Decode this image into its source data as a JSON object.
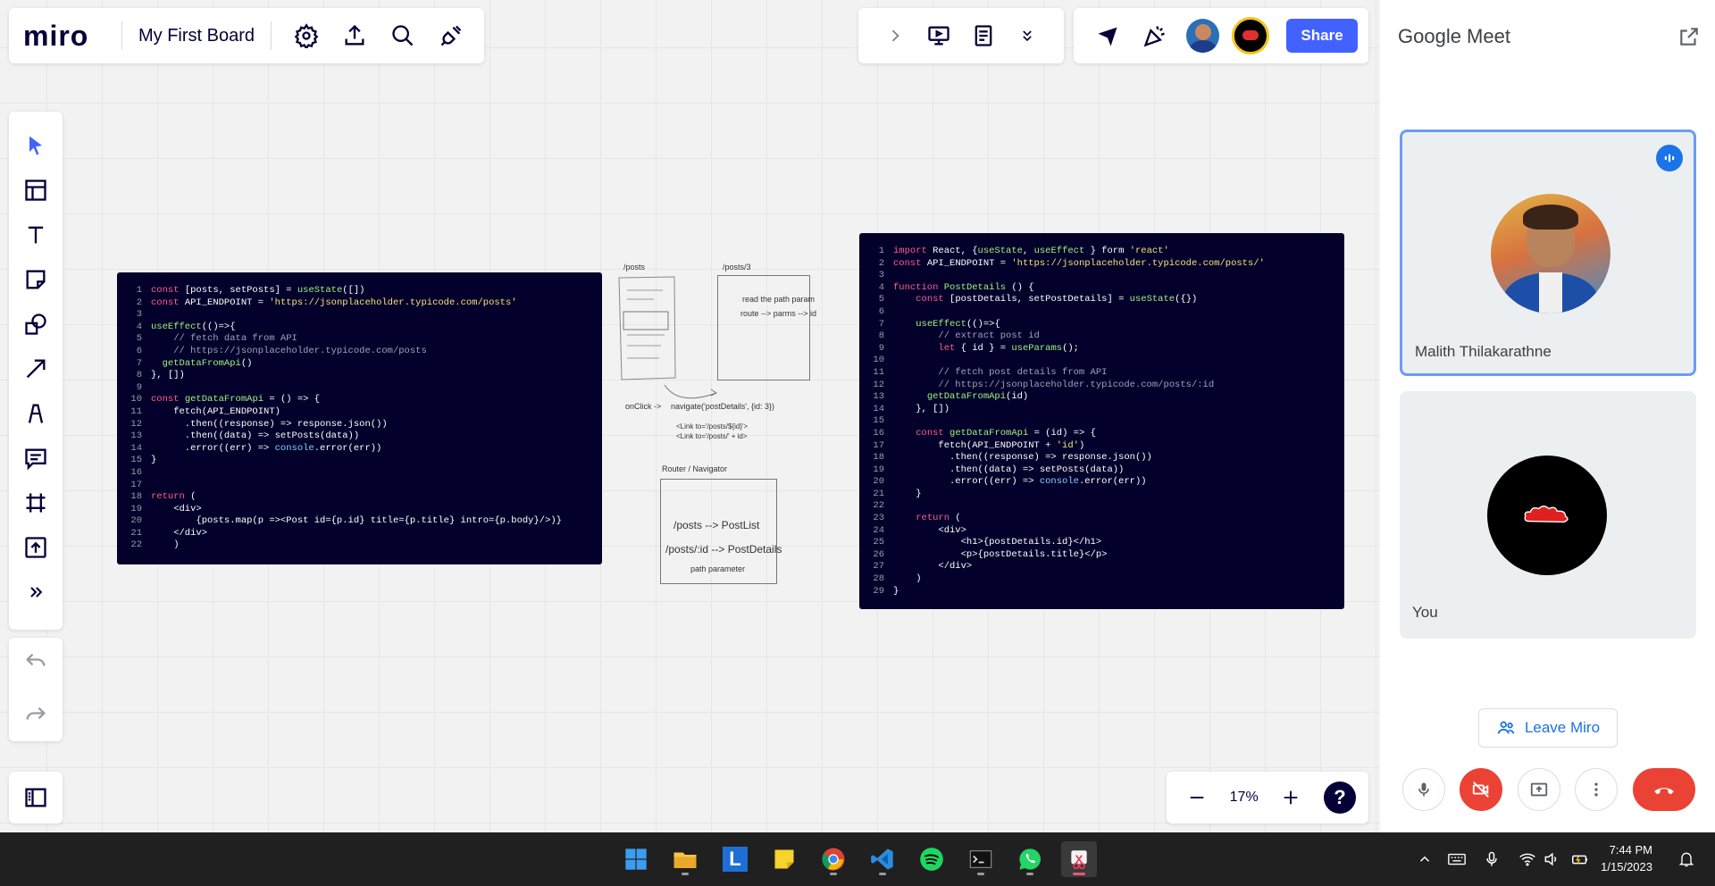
{
  "app": {
    "logo": "miro",
    "board_title": "My First Board",
    "share_label": "Share",
    "zoom": "17%",
    "help_symbol": "?"
  },
  "left_tools": [
    "select-icon",
    "templates-icon",
    "text-icon",
    "sticky-note-icon",
    "shapes-icon",
    "arrow-icon",
    "pen-icon",
    "comment-icon",
    "frame-icon",
    "upload-icon",
    "more-tools-icon"
  ],
  "code_left": [
    {
      "n": "1",
      "code": "const [posts, setPosts] = useState([])"
    },
    {
      "n": "2",
      "code": "const API_ENDPOINT = 'https://jsonplaceholder.typicode.com/posts'"
    },
    {
      "n": "3",
      "code": ""
    },
    {
      "n": "4",
      "code": "useEffect(()=>{"
    },
    {
      "n": "5",
      "code": "    // fetch data from API"
    },
    {
      "n": "6",
      "code": "    // https://jsonplaceholder.typicode.com/posts"
    },
    {
      "n": "7",
      "code": "  getDataFromApi()"
    },
    {
      "n": "8",
      "code": "}, [])"
    },
    {
      "n": "9",
      "code": ""
    },
    {
      "n": "10",
      "code": "const getDataFromApi = () => {"
    },
    {
      "n": "11",
      "code": "    fetch(API_ENDPOINT)"
    },
    {
      "n": "12",
      "code": "      .then((response) => response.json())"
    },
    {
      "n": "13",
      "code": "      .then((data) => setPosts(data))"
    },
    {
      "n": "14",
      "code": "      .error((err) => console.error(err))"
    },
    {
      "n": "15",
      "code": "}"
    },
    {
      "n": "16",
      "code": ""
    },
    {
      "n": "17",
      "code": ""
    },
    {
      "n": "18",
      "code": "return ("
    },
    {
      "n": "19",
      "code": "    <div>"
    },
    {
      "n": "20",
      "code": "        {posts.map(p =><Post id={p.id} title={p.title} intro={p.body}/>)}"
    },
    {
      "n": "21",
      "code": "    </div>"
    },
    {
      "n": "22",
      "code": "    )"
    }
  ],
  "code_right": [
    {
      "n": "1",
      "code": "import React, {useState, useEffect } form 'react'"
    },
    {
      "n": "2",
      "code": "const API_ENDPOINT = 'https://jsonplaceholder.typicode.com/posts/'"
    },
    {
      "n": "3",
      "code": ""
    },
    {
      "n": "4",
      "code": "function PostDetails () {"
    },
    {
      "n": "5",
      "code": "    const [postDetails, setPostDetails] = useState({})"
    },
    {
      "n": "6",
      "code": ""
    },
    {
      "n": "7",
      "code": "    useEffect(()=>{"
    },
    {
      "n": "8",
      "code": "        // extract post id"
    },
    {
      "n": "9",
      "code": "        let { id } = useParams();"
    },
    {
      "n": "10",
      "code": ""
    },
    {
      "n": "11",
      "code": "        // fetch post details from API"
    },
    {
      "n": "12",
      "code": "        // https://jsonplaceholder.typicode.com/posts/:id"
    },
    {
      "n": "13",
      "code": "      getDataFromApi(id)"
    },
    {
      "n": "14",
      "code": "    }, [])"
    },
    {
      "n": "15",
      "code": ""
    },
    {
      "n": "16",
      "code": "    const getDataFromApi = (id) => {"
    },
    {
      "n": "17",
      "code": "        fetch(API_ENDPOINT + 'id')"
    },
    {
      "n": "18",
      "code": "          .then((response) => response.json())"
    },
    {
      "n": "19",
      "code": "          .then((data) => setPosts(data))"
    },
    {
      "n": "20",
      "code": "          .error((err) => console.error(err))"
    },
    {
      "n": "21",
      "code": "    }"
    },
    {
      "n": "22",
      "code": ""
    },
    {
      "n": "23",
      "code": "    return ("
    },
    {
      "n": "24",
      "code": "        <div>"
    },
    {
      "n": "25",
      "code": "            <h1>{postDetails.id}</h1>"
    },
    {
      "n": "26",
      "code": "            <p>{postDetails.title}</p>"
    },
    {
      "n": "27",
      "code": "        </div>"
    },
    {
      "n": "28",
      "code": "    )"
    },
    {
      "n": "29",
      "code": "}"
    }
  ],
  "sketch": {
    "posts_label": "/posts",
    "posts3_label": "/posts/3",
    "read_path": "read the path param",
    "route_parms": "route --> parms --> id",
    "onclick": "onClick ->",
    "navigate": "navigate('postDetails', {id: 3})",
    "link1": "<Link to='/posts/${id}'>",
    "link2": "<Link to='/posts/' + id>",
    "router_label": "Router /  Navigator",
    "route1": "/posts --> PostList",
    "route2": "/posts/:id --> PostDetails",
    "path_param": "path parameter"
  },
  "meet": {
    "title": "Google Meet",
    "participant1": "Malith Thilakarathne",
    "participant2": "You",
    "leave_label": "Leave Miro"
  },
  "taskbar": {
    "time": "7:44 PM",
    "date": "1/15/2023"
  },
  "colors": {
    "miro_blue": "#4262ff",
    "code_bg": "#03012b",
    "meet_red": "#ea4335"
  }
}
